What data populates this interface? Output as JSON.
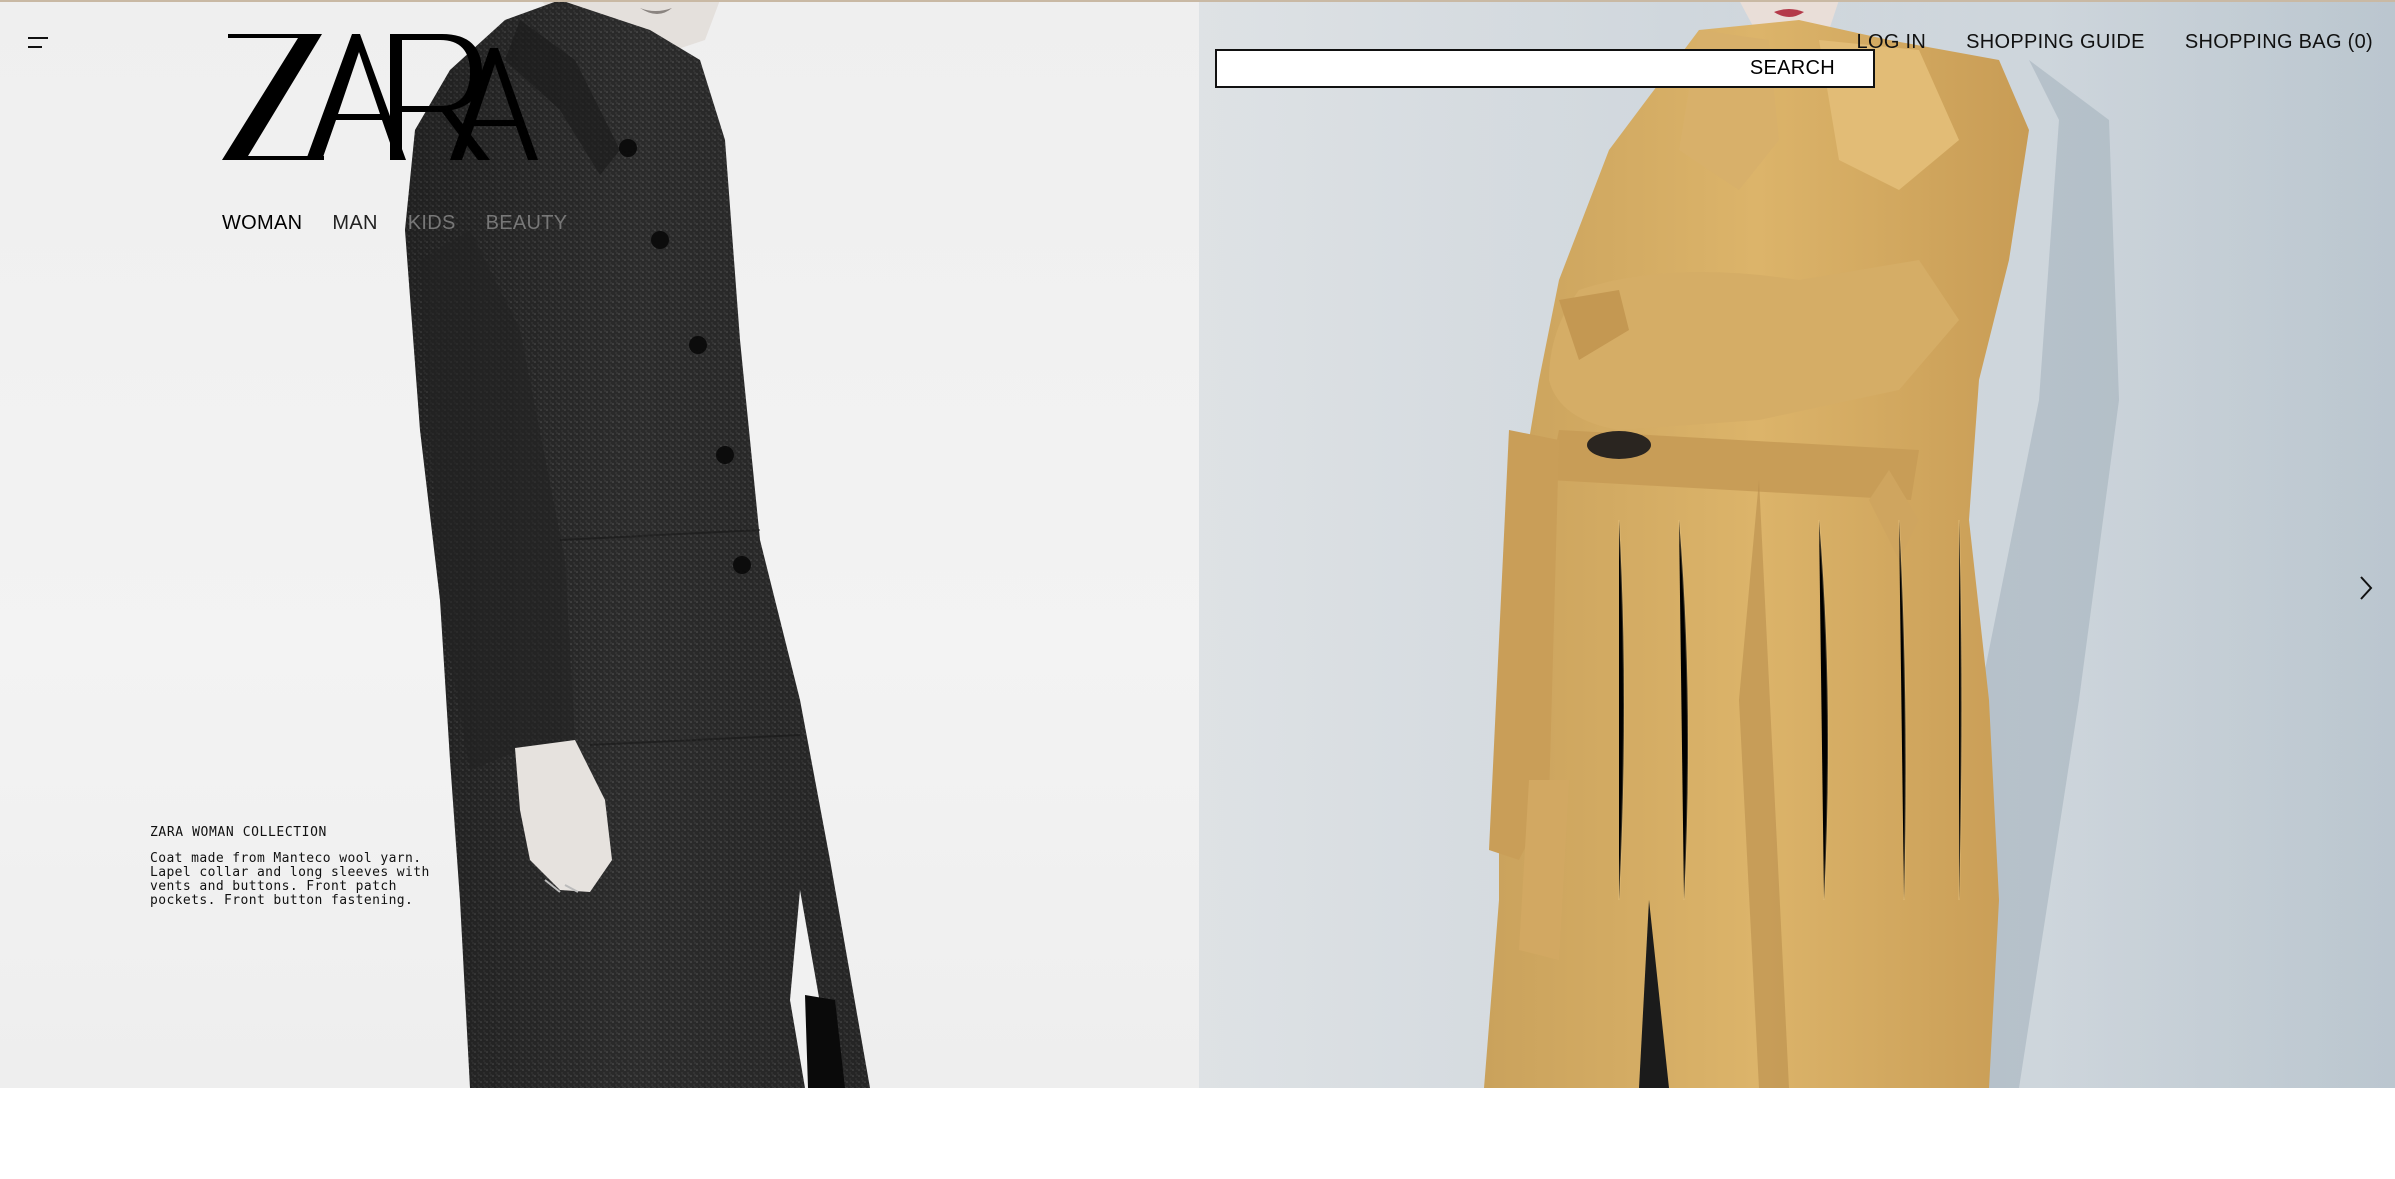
{
  "header": {
    "menu_icon": "hamburger-menu-icon",
    "logo_text": "ZARA",
    "search_label": "SEARCH",
    "login_label": "LOG IN",
    "shopping_guide_label": "SHOPPING GUIDE",
    "shopping_bag_label": "SHOPPING BAG (0)"
  },
  "nav": {
    "items": [
      {
        "label": "WOMAN"
      },
      {
        "label": "MAN"
      },
      {
        "label": "KIDS"
      },
      {
        "label": "BEAUTY"
      }
    ]
  },
  "hero": {
    "caption_title": "ZARA WOMAN COLLECTION",
    "caption_description": "Coat made from Manteco wool yarn. Lapel collar and long sleeves with vents and buttons. Front patch pockets. Front button fastening.",
    "next_icon": "chevron-right-icon"
  },
  "colors": {
    "left_panel_bg": "#efefef",
    "right_panel_bg": "#d3d9de",
    "dark_coat": "#2a2a2a",
    "camel_coat": "#d2a75e"
  }
}
